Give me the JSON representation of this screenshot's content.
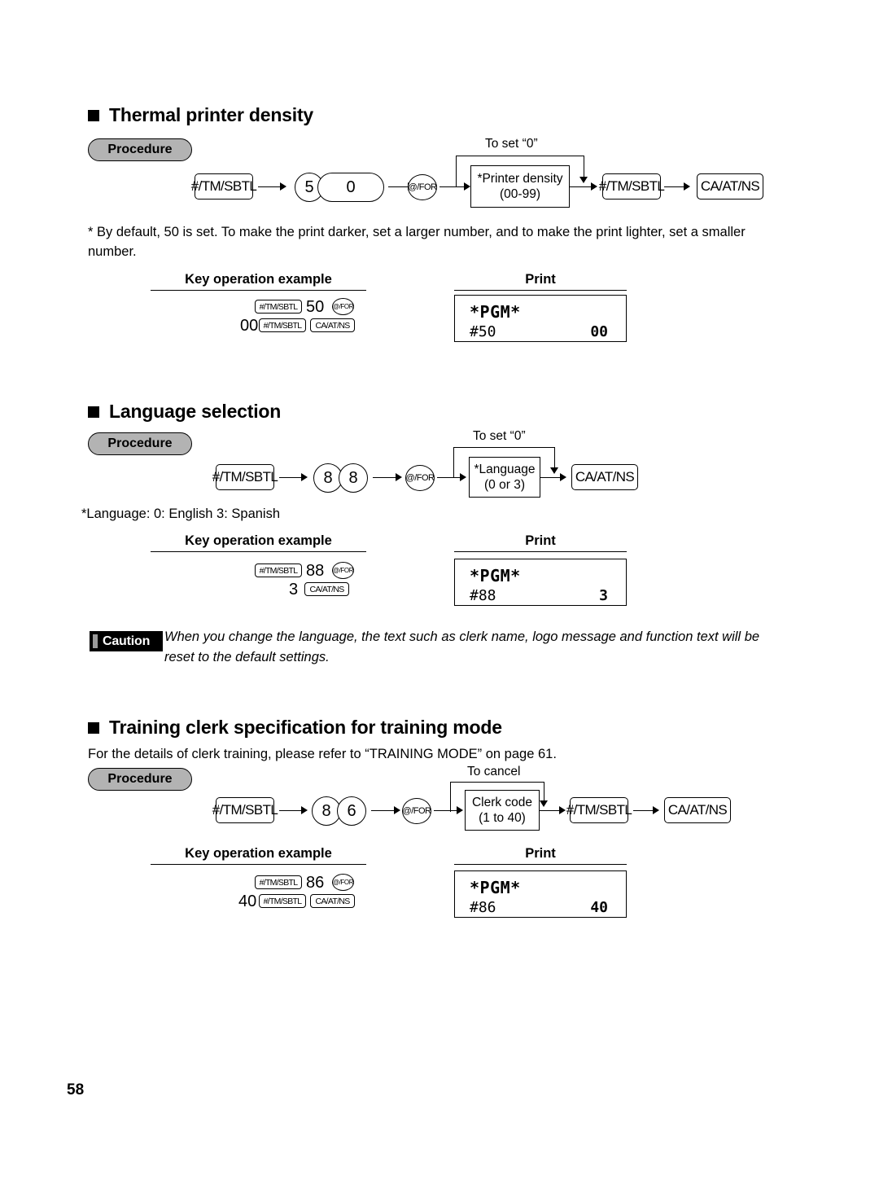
{
  "document": {
    "page_number": "58"
  },
  "sections": [
    {
      "id": "thermal-printer-density",
      "title": "Thermal printer density",
      "procedure_label": "Procedure",
      "flow": {
        "start_key": "#/TM/SBTL",
        "digit1": "5",
        "digit2": "0",
        "for_key": "@/FOR",
        "loop_label": "To set “0”",
        "data_line1": "*Printer density",
        "data_line2": "(00-99)",
        "end_key1": "#/TM/SBTL",
        "end_key2": "CA/AT/NS"
      },
      "note": "* By default, 50 is set.  To make the print darker, set a larger number, and to make the print lighter, set a smaller number.",
      "example_header": "Key operation example",
      "print_header": "Print",
      "example": {
        "row1_key1": "#/TM/SBTL",
        "row1_num": "50",
        "row1_key2": "@/FOR",
        "row2_num": "00",
        "row2_key1": "#/TM/SBTL",
        "row2_key2": "CA/AT/NS"
      },
      "print": {
        "title": "*PGM*",
        "code": "#50",
        "value": "00"
      }
    },
    {
      "id": "language-selection",
      "title": "Language selection",
      "procedure_label": "Procedure",
      "flow": {
        "start_key": "#/TM/SBTL",
        "digit1": "8",
        "digit2": "8",
        "for_key": "@/FOR",
        "loop_label": "To set “0”",
        "data_line1": "*Language",
        "data_line2": "(0 or 3)",
        "end_key1": "CA/AT/NS"
      },
      "note": "*Language: 0: English       3: Spanish",
      "example_header": "Key operation example",
      "print_header": "Print",
      "example": {
        "row1_key1": "#/TM/SBTL",
        "row1_num": "88",
        "row1_key2": "@/FOR",
        "row2_num": "3",
        "row2_key2": "CA/AT/NS"
      },
      "print": {
        "title": "*PGM*",
        "code": "#88",
        "value": "3"
      }
    },
    {
      "id": "training-clerk-specification",
      "title": "Training clerk specification for training mode",
      "intro": "For the details of clerk training, please refer to “TRAINING MODE” on page 61.",
      "procedure_label": "Procedure",
      "flow": {
        "start_key": "#/TM/SBTL",
        "digit1": "8",
        "digit2": "6",
        "for_key": "@/FOR",
        "loop_label": "To cancel",
        "data_line1": "Clerk code",
        "data_line2": "(1 to 40)",
        "end_key1": "#/TM/SBTL",
        "end_key2": "CA/AT/NS"
      },
      "example_header": "Key operation example",
      "print_header": "Print",
      "example": {
        "row1_key1": "#/TM/SBTL",
        "row1_num": "86",
        "row1_key2": "@/FOR",
        "row2_num": "40",
        "row2_key1": "#/TM/SBTL",
        "row2_key2": "CA/AT/NS"
      },
      "print": {
        "title": "*PGM*",
        "code": "#86",
        "value": "40"
      }
    }
  ],
  "caution": {
    "label": "Caution",
    "text_line1": "When you change the language, the text such as clerk name, logo message and function text will",
    "text_line2": "be reset to the default settings."
  }
}
